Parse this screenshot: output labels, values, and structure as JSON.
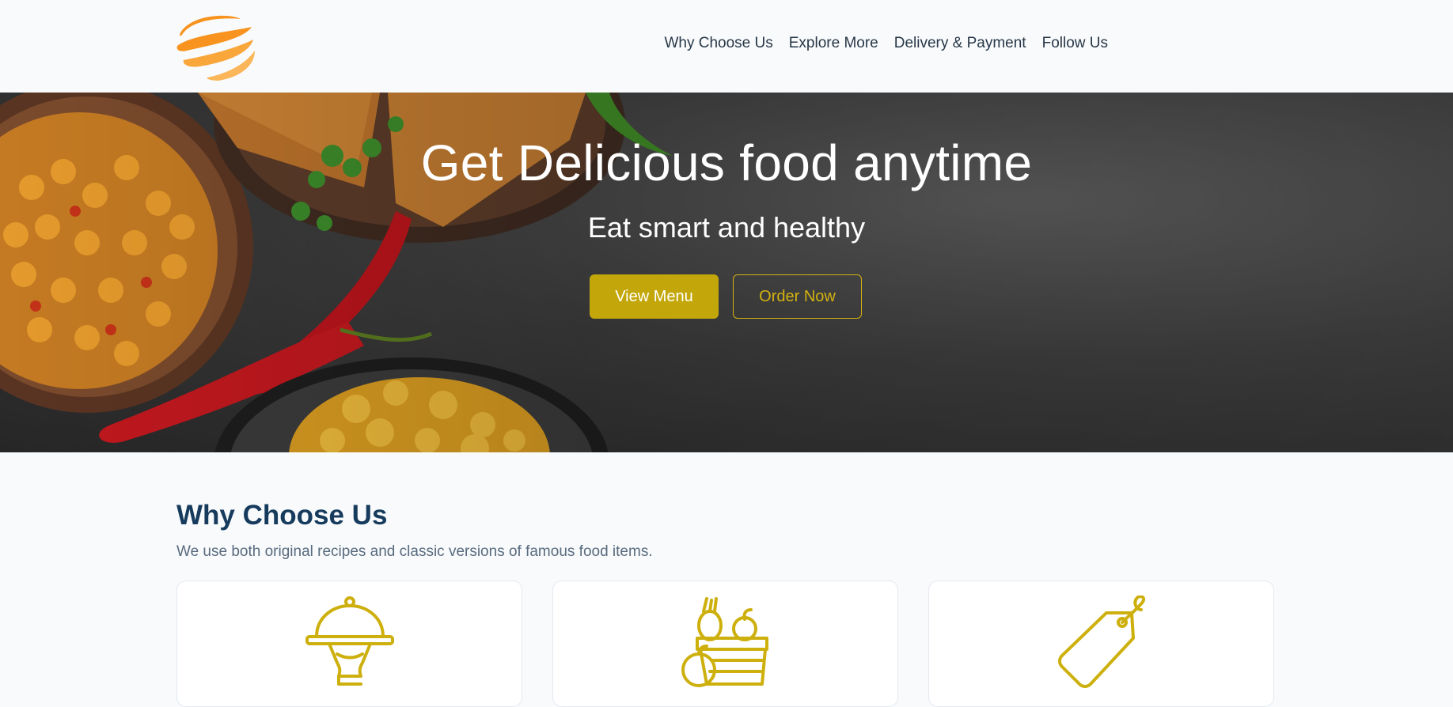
{
  "brand": {
    "logo_icon": "swoosh-logo-icon",
    "accent": "#f7931e",
    "gold": "#c9ad0c"
  },
  "nav": {
    "items": [
      {
        "label": "Why Choose Us"
      },
      {
        "label": "Explore More"
      },
      {
        "label": "Delivery & Payment"
      },
      {
        "label": "Follow Us"
      }
    ]
  },
  "hero": {
    "title": "Get Delicious food anytime",
    "subtitle": "Eat smart and healthy",
    "primary_button": "View Menu",
    "secondary_button": "Order Now"
  },
  "why": {
    "title": "Why Choose Us",
    "description": "We use both original recipes and classic versions of famous food items.",
    "cards": [
      {
        "icon": "food-cloche-icon"
      },
      {
        "icon": "fresh-produce-basket-icon"
      },
      {
        "icon": "price-tag-icon"
      }
    ]
  }
}
